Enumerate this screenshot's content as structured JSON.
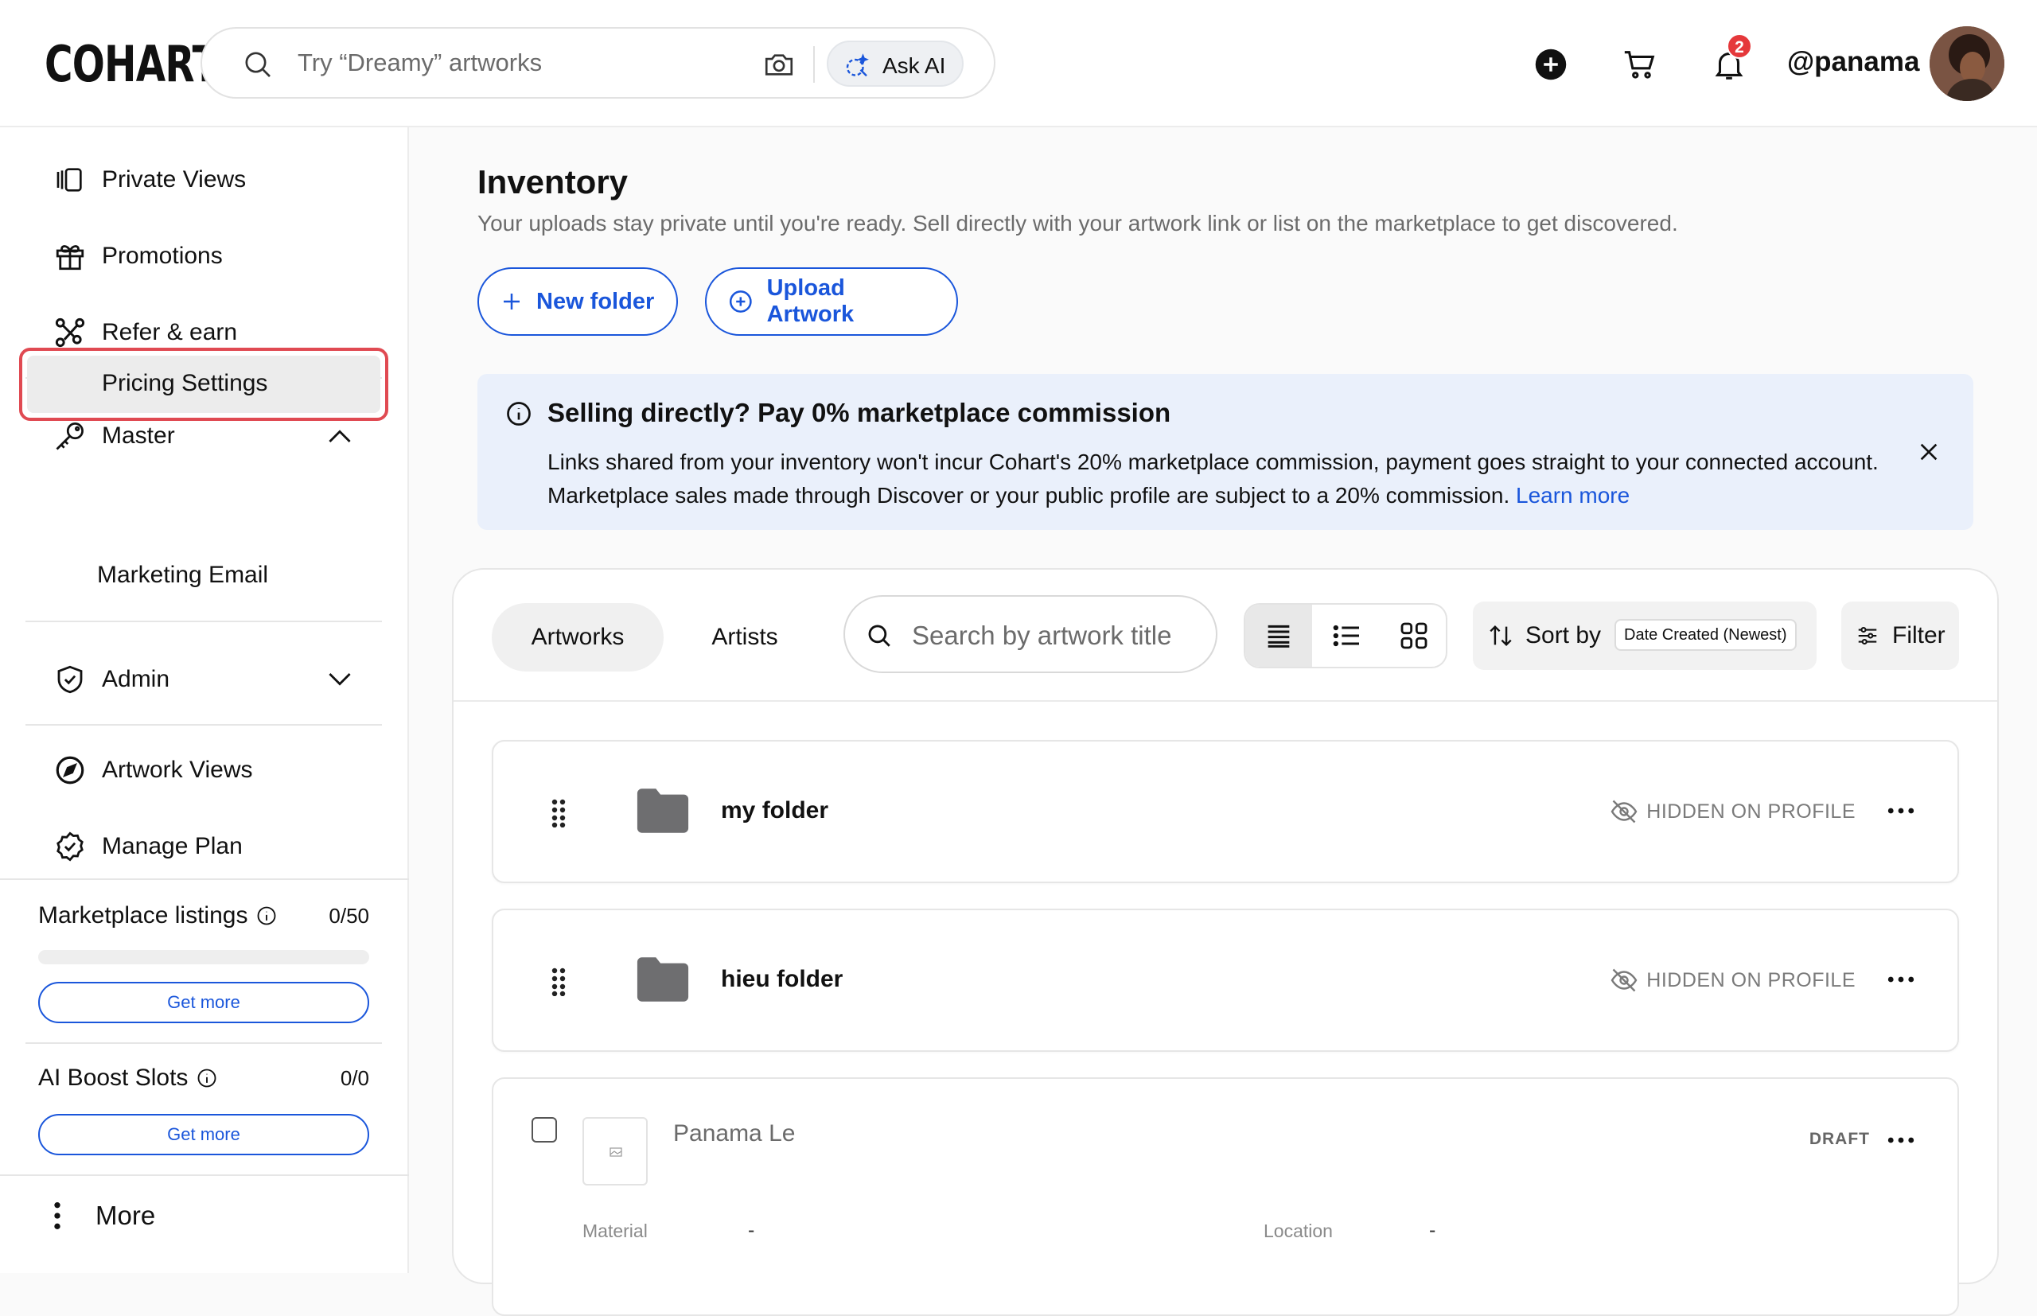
{
  "brand": {
    "logo": "COHART",
    "accent": "#1a56db",
    "danger": "#e5383b"
  },
  "search": {
    "placeholder": "Try “Dreamy” artworks",
    "ask_ai": "Ask AI"
  },
  "header": {
    "notification_count": "2",
    "username": "@panama"
  },
  "sidebar": {
    "items": [
      {
        "label": "Private Views",
        "icon": "private-views-icon"
      },
      {
        "label": "Promotions",
        "icon": "gift-icon"
      },
      {
        "label": "Refer & earn",
        "icon": "share-icon"
      }
    ],
    "master": {
      "label": "Master",
      "icon": "key-icon",
      "children": [
        "Pricing Settings",
        "Marketing Email"
      ]
    },
    "admin": {
      "label": "Admin",
      "icon": "shield-check-icon"
    },
    "bottom_items": [
      {
        "label": "Artwork Views",
        "icon": "compass-icon"
      },
      {
        "label": "Manage Plan",
        "icon": "badge-check-icon"
      }
    ],
    "marketplace": {
      "label": "Marketplace listings",
      "value": "0/50",
      "button": "Get more",
      "fill": 0
    },
    "ai_boost": {
      "label": "AI Boost Slots",
      "value": "0/0",
      "button": "Get more"
    },
    "more": "More"
  },
  "main": {
    "title": "Inventory",
    "subtitle": "Your uploads stay private until you're ready. Sell directly with your artwork link or list on the marketplace to get discovered.",
    "new_folder": "New folder",
    "upload": "Upload Artwork",
    "banner": {
      "title": "Selling directly? Pay 0% marketplace commission",
      "text": "Links shared from your inventory won't incur Cohart's 20% marketplace commission, payment goes straight to your connected account. Marketplace sales made through Discover or your public profile are subject to a 20% commission.",
      "link": "Learn more"
    },
    "tabs": [
      "Artworks",
      "Artists"
    ],
    "search_placeholder": "Search by artwork title",
    "sort_label": "Sort by",
    "sort_value": "Date Created (Newest)",
    "filter": "Filter",
    "folders": [
      {
        "name": "my folder",
        "status": "HIDDEN ON PROFILE"
      },
      {
        "name": "hieu folder",
        "status": "HIDDEN ON PROFILE"
      }
    ],
    "artwork": {
      "artist": "Panama Le",
      "status": "DRAFT",
      "material_label": "Material",
      "material_value": "-",
      "location_label": "Location",
      "location_value": "-"
    }
  }
}
